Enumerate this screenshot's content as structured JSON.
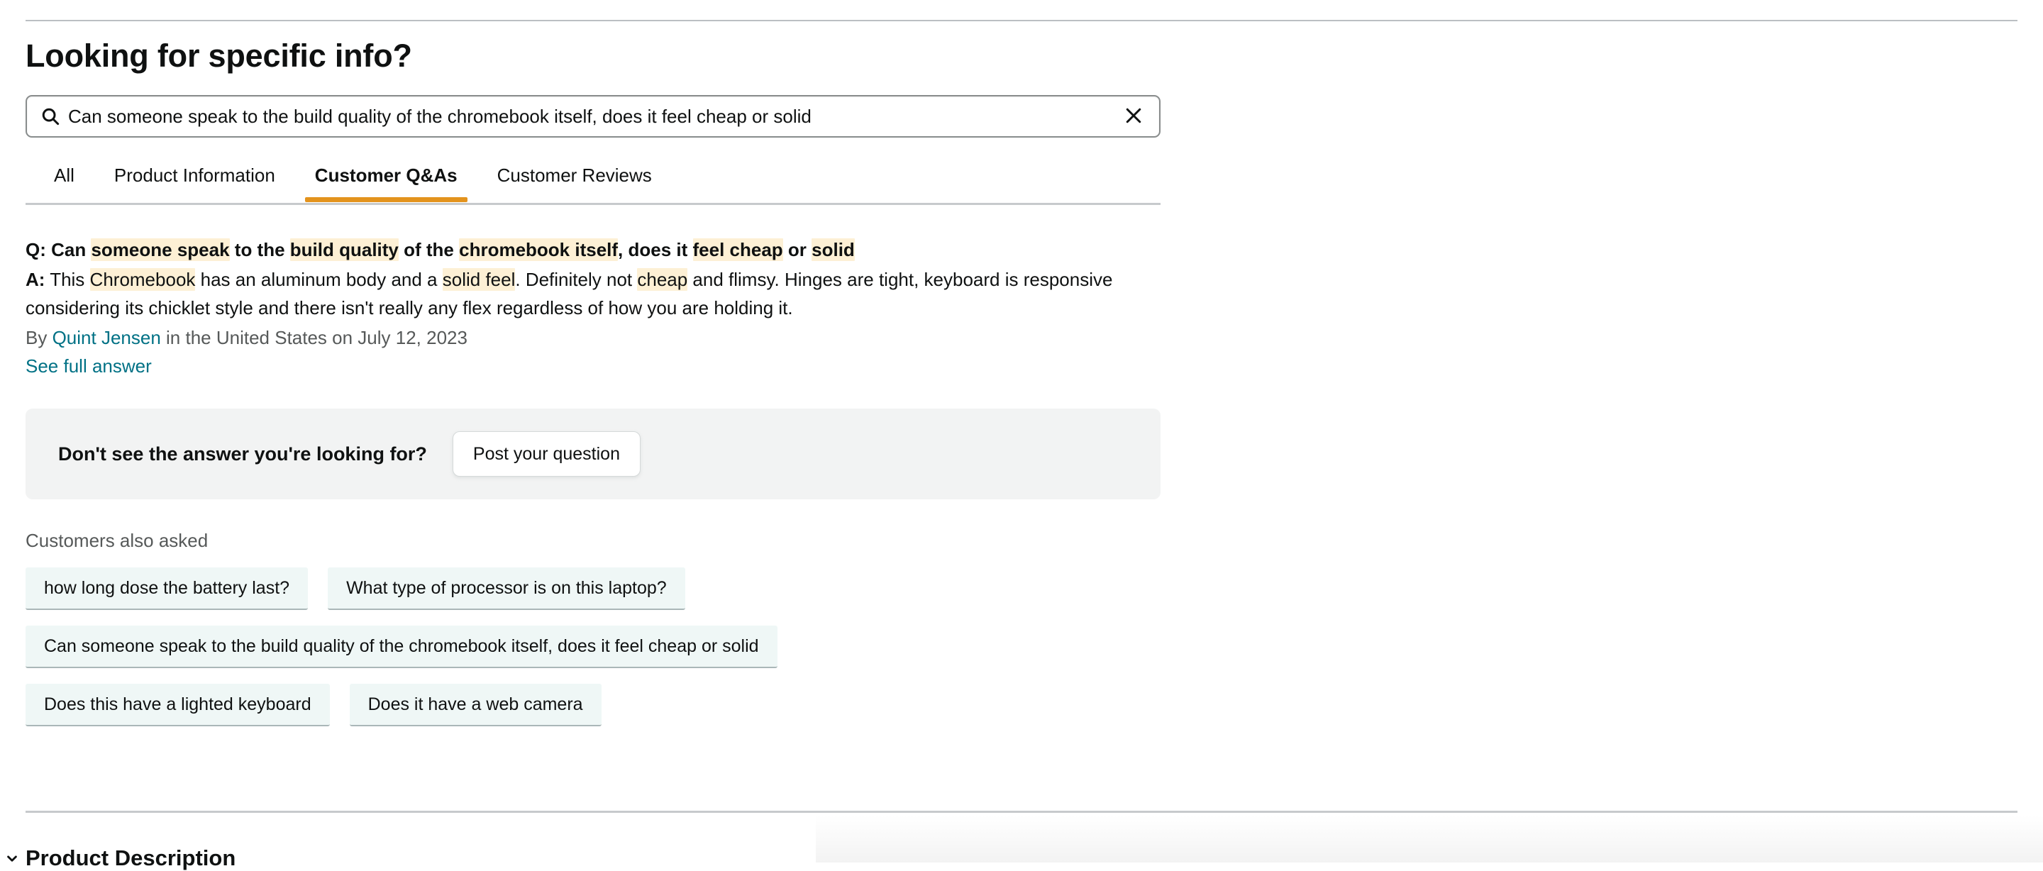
{
  "page": {
    "title": "Looking for specific info?"
  },
  "search": {
    "value": "Can someone speak to the build quality of the chromebook itself, does it feel cheap or solid",
    "placeholder": "Search in reviews, Q&A...",
    "search_icon": "search-icon",
    "clear_icon": "close-icon"
  },
  "tabs": [
    {
      "label": "All",
      "active": false
    },
    {
      "label": "Product Information",
      "active": false
    },
    {
      "label": "Customer Q&As",
      "active": true
    },
    {
      "label": "Customer Reviews",
      "active": false
    }
  ],
  "qa": {
    "q_prefix": "Q:",
    "question_parts": [
      {
        "text": " Can ",
        "hl": false
      },
      {
        "text": "someone speak",
        "hl": true
      },
      {
        "text": " to the ",
        "hl": false
      },
      {
        "text": "build quality",
        "hl": true
      },
      {
        "text": " of the ",
        "hl": false
      },
      {
        "text": "chromebook itself",
        "hl": true
      },
      {
        "text": ", does it ",
        "hl": false
      },
      {
        "text": "feel cheap",
        "hl": true
      },
      {
        "text": " or ",
        "hl": false
      },
      {
        "text": "solid",
        "hl": true
      }
    ],
    "a_prefix": "A:",
    "answer_parts": [
      {
        "text": " This ",
        "hl": false
      },
      {
        "text": "Chromebook",
        "hl": true
      },
      {
        "text": " has an aluminum body and a ",
        "hl": false
      },
      {
        "text": "solid feel",
        "hl": true
      },
      {
        "text": ". Definitely not ",
        "hl": false
      },
      {
        "text": "cheap",
        "hl": true
      },
      {
        "text": " and flimsy. Hinges are tight, keyboard is responsive considering its chicklet style and there isn't really any flex regardless of how you are holding it.",
        "hl": false
      }
    ],
    "byline_prefix": "By ",
    "author": "Quint Jensen",
    "byline_suffix": " in the United States on July 12, 2023",
    "see_full_answer": "See full answer"
  },
  "ask_box": {
    "label": "Don't see the answer you're looking for?",
    "post_button": "Post your question"
  },
  "also_asked": {
    "label": "Customers also asked",
    "rows": [
      [
        "how long dose the battery last?",
        "What type of processor is on this laptop?"
      ],
      [
        "Can someone speak to the build quality of the chromebook itself, does it feel cheap or solid"
      ],
      [
        "Does this have a lighted keyboard",
        "Does it have a web camera"
      ]
    ]
  },
  "next_section": {
    "chevron_icon": "chevron-down-icon",
    "title": "Product Description"
  },
  "colors": {
    "accent_orange": "#e3931d",
    "link_teal": "#007185",
    "highlight_yellow": "#fdf0d5",
    "chip_bg": "#eff7f6",
    "panel_gray": "#f2f3f3"
  }
}
